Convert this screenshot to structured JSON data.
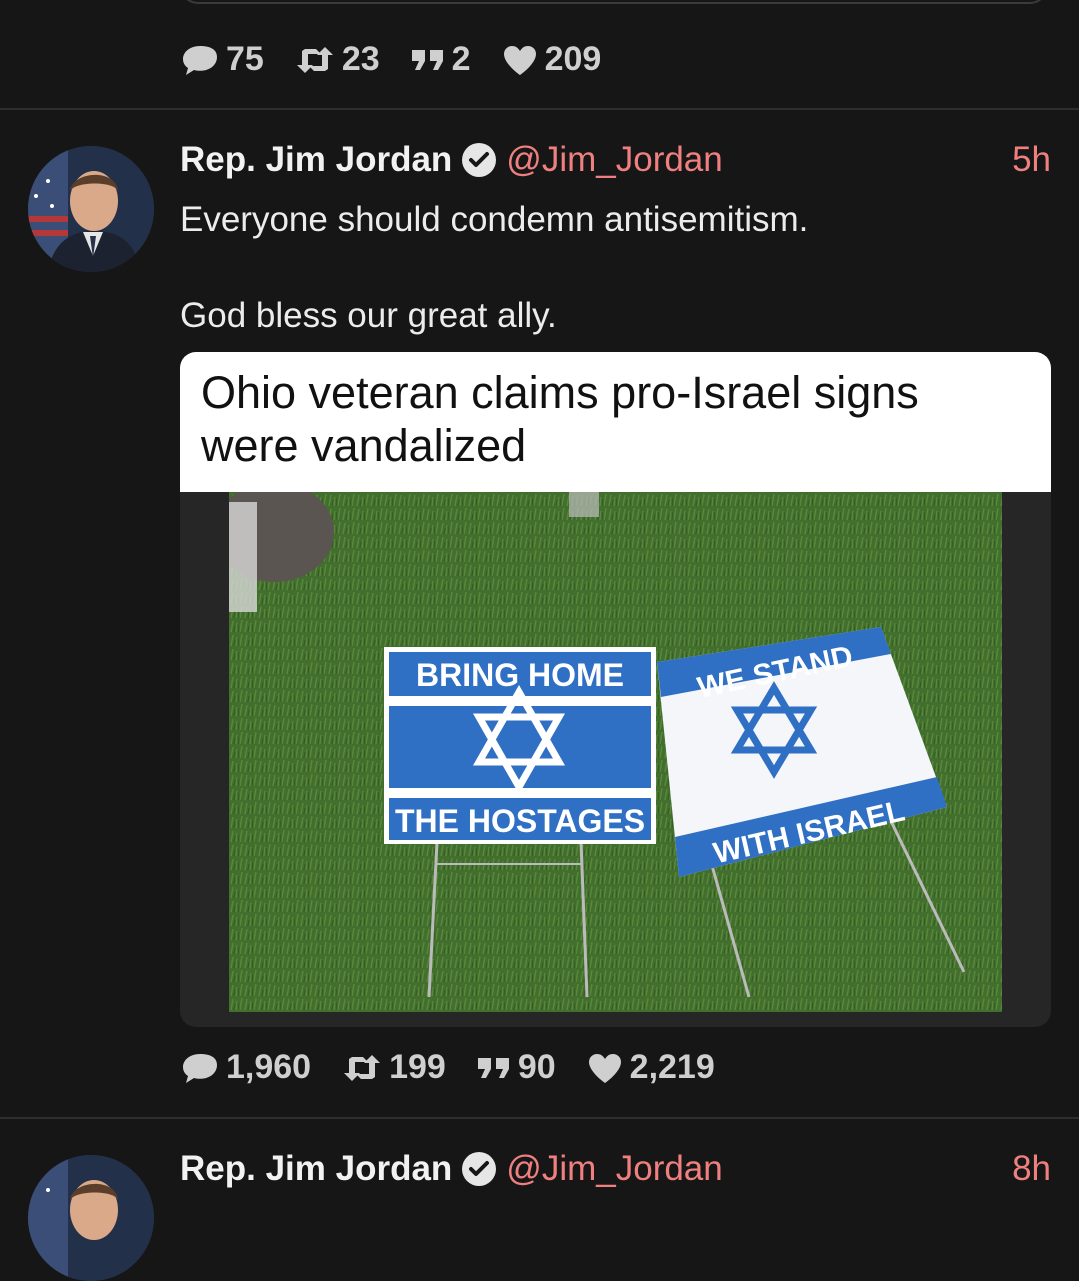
{
  "prev_tweet": {
    "stats": {
      "replies": "75",
      "retweets": "23",
      "quotes": "2",
      "likes": "209"
    }
  },
  "tweet": {
    "author_name": "Rep. Jim Jordan",
    "handle": "@Jim_Jordan",
    "time": "5h",
    "text_line1": "Everyone should condemn antisemitism.",
    "text_line2": "God bless our great ally.",
    "media": {
      "headline": "Ohio veteran claims pro-Israel signs were vandalized",
      "sign1_top": "BRING HOME",
      "sign1_bottom": "THE HOSTAGES",
      "sign2_top": "WE STAND",
      "sign2_bottom": "WITH ISRAEL"
    },
    "stats": {
      "replies": "1,960",
      "retweets": "199",
      "quotes": "90",
      "likes": "2,219"
    }
  },
  "next_tweet": {
    "author_name": "Rep. Jim Jordan",
    "handle": "@Jim_Jordan",
    "time": "8h"
  },
  "colors": {
    "background": "#161616",
    "accent_handle": "#f08080",
    "sign_blue": "#2f6fc4"
  },
  "icons": [
    "reply-icon",
    "retweet-icon",
    "quote-icon",
    "like-icon",
    "verified-badge-icon"
  ]
}
